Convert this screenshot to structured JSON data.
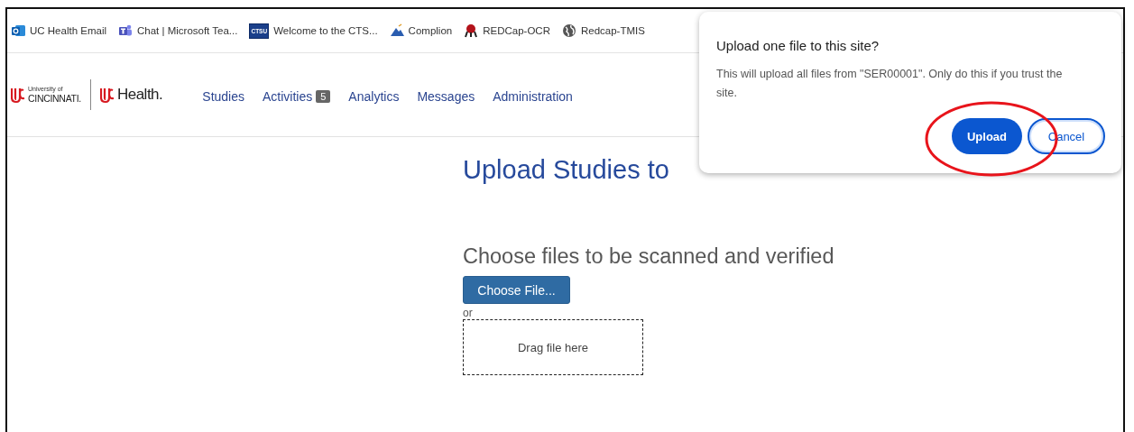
{
  "bookmarks": [
    {
      "kind": "mail",
      "label": "UC Health Email"
    },
    {
      "kind": "chat",
      "label": "Chat | Microsoft Tea..."
    },
    {
      "kind": "badge",
      "badge_text": "CTSU",
      "label": "Welcome to the CTS..."
    },
    {
      "kind": "peak",
      "label": "Complion"
    },
    {
      "kind": "figure",
      "label": "REDCap-OCR"
    },
    {
      "kind": "globe",
      "label": "Redcap-TMIS"
    }
  ],
  "logos": [
    {
      "small": "University of",
      "main": "CINCINNATI."
    },
    {
      "main": "Health."
    }
  ],
  "nav": [
    {
      "label": "Studies"
    },
    {
      "label": "Activities",
      "badge": "5"
    },
    {
      "label": "Analytics"
    },
    {
      "label": "Messages"
    },
    {
      "label": "Administration"
    }
  ],
  "page": {
    "heading": "Upload Studies to",
    "subheading": "Choose files to be scanned and verified",
    "choose_button": "Choose File...",
    "or": "or",
    "drop_zone": "Drag file here"
  },
  "dialog": {
    "title": "Upload one file to this site?",
    "message": "This will upload all files from \"SER00001\". Only do this if you trust the site.",
    "buttons": [
      {
        "label": "Upload",
        "kind": "primary"
      },
      {
        "label": "Cancel",
        "kind": "secondary"
      }
    ]
  }
}
